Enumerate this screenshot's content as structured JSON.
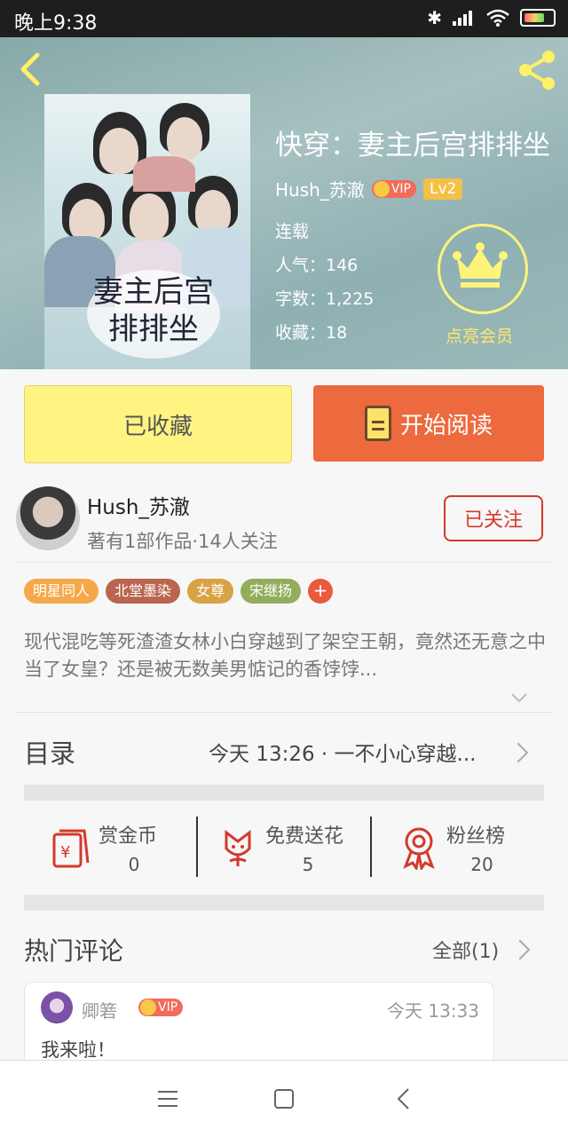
{
  "status_bar": {
    "time": "晚上9:38"
  },
  "book": {
    "title": "快穿：妻主后宫排排坐",
    "cover_text": "妻主后宫排排坐",
    "author": "Hush_苏澈",
    "vip_label": "VIP",
    "level": "Lv2",
    "status": "连载",
    "popularity": "人气：146",
    "word_count": "字数：1,225",
    "favorites": "收藏：18",
    "vip_cta": "点亮会员"
  },
  "actions": {
    "favorited_label": "已收藏",
    "read_label": "开始阅读"
  },
  "author_card": {
    "name": "Hush_苏澈",
    "stats": "著有1部作品·14人关注",
    "follow_label": "已关注"
  },
  "tags": [
    {
      "label": "明星同人",
      "color": "#f5a84a"
    },
    {
      "label": "北堂墨染",
      "color": "#b9654f"
    },
    {
      "label": "女尊",
      "color": "#d8a345"
    },
    {
      "label": "宋继扬",
      "color": "#93ad5a"
    }
  ],
  "tag_add": "+",
  "summary": "现代混吃等死渣渣女林小白穿越到了架空王朝，竟然还无意之中当了女皇？还是被无数美男惦记的香饽饽...",
  "toc": {
    "title": "目录",
    "latest": "今天 13:26 · 一不小心穿越..."
  },
  "stats": [
    {
      "label": "赏金币",
      "value": "0",
      "icon": "reward-coin-icon"
    },
    {
      "label": "免费送花",
      "value": "5",
      "icon": "flower-icon"
    },
    {
      "label": "粉丝榜",
      "value": "20",
      "icon": "medal-icon"
    }
  ],
  "comments": {
    "title": "热门评论",
    "all_label": "全部(1)",
    "items": [
      {
        "user": "卿箬",
        "vip_label": "VIP",
        "time": "今天 13:33",
        "text": "我来啦！"
      }
    ]
  },
  "colors": {
    "accent_orange": "#ec6a3e",
    "fav_yellow": "#fff481",
    "follow_red": "#d23a2b",
    "vip_gold": "#fff37a"
  }
}
